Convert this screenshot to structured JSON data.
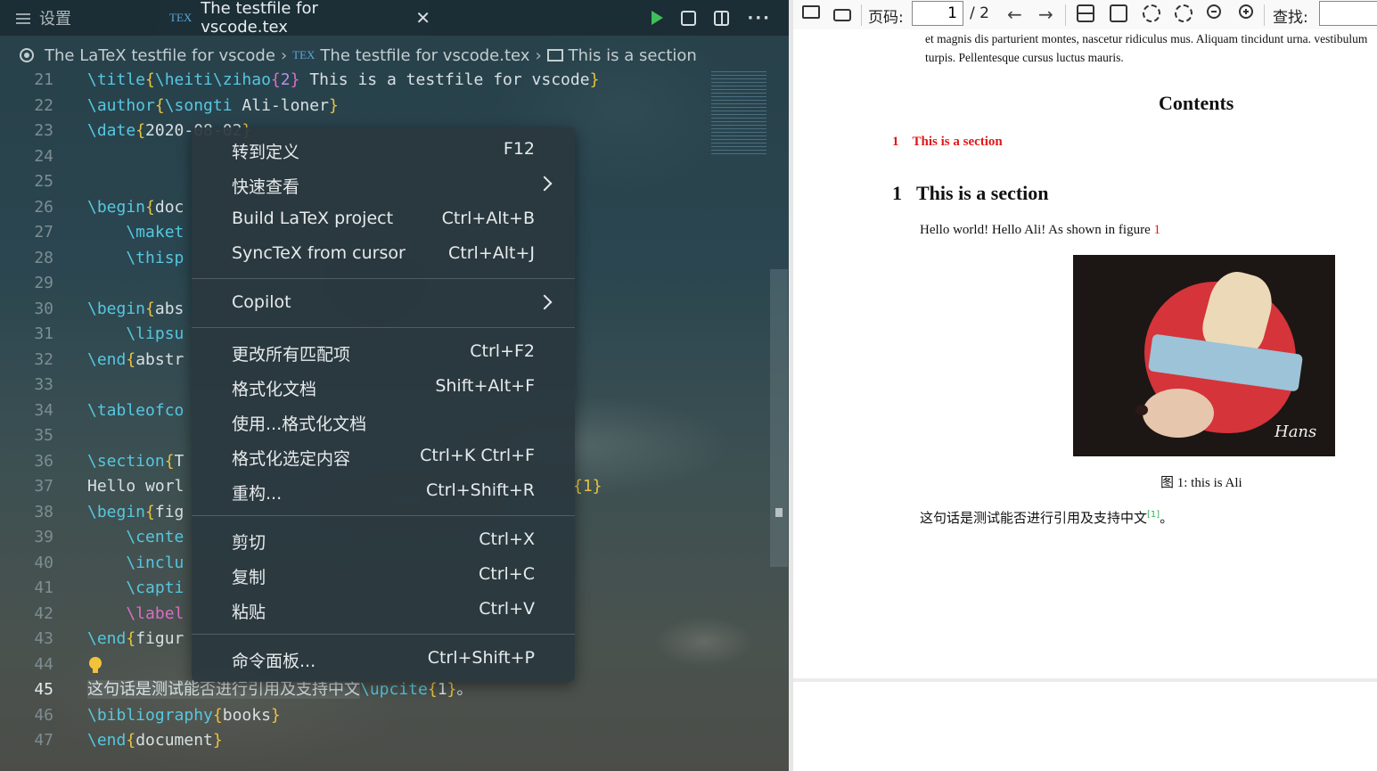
{
  "editor": {
    "tabs": {
      "settings": "设置",
      "active": "The testfile for vscode.tex",
      "tex_icon": "TEX"
    },
    "breadcrumb": {
      "folder": "The LaTeX testfile for vscode",
      "file": "The testfile for vscode.tex",
      "section": "This is a section"
    },
    "lines": [
      {
        "no": "21",
        "text": "\\title{\\heiti\\zihao{2} This is a testfile for vscode}"
      },
      {
        "no": "22",
        "text": "\\author{\\songti Ali-loner}"
      },
      {
        "no": "23",
        "text": "\\date{2020-08-02}"
      },
      {
        "no": "24",
        "text": ""
      },
      {
        "no": "25",
        "text": ""
      },
      {
        "no": "26",
        "text": "\\begin{doc"
      },
      {
        "no": "27",
        "text": "    \\maket"
      },
      {
        "no": "28",
        "text": "    \\thisp"
      },
      {
        "no": "29",
        "text": ""
      },
      {
        "no": "30",
        "text": "\\begin{abs"
      },
      {
        "no": "31",
        "text": "    \\lipsu"
      },
      {
        "no": "32",
        "text": "\\end{abstr"
      },
      {
        "no": "33",
        "text": ""
      },
      {
        "no": "34",
        "text": "\\tableofco"
      },
      {
        "no": "35",
        "text": ""
      },
      {
        "no": "36",
        "text": "\\section{T"
      },
      {
        "no": "37",
        "text": "Hello worl"
      },
      {
        "no": "38",
        "text": "\\begin{fig"
      },
      {
        "no": "39",
        "text": "    \\cente"
      },
      {
        "no": "40",
        "text": "    \\inclu"
      },
      {
        "no": "41",
        "text": "    \\capti"
      },
      {
        "no": "42",
        "text": "    \\label"
      },
      {
        "no": "43",
        "text": "\\end{figur"
      },
      {
        "no": "44",
        "text": ""
      },
      {
        "no": "45",
        "text": "这句话是测试能否进行引用及支持中文\\upcite{1}。"
      },
      {
        "no": "46",
        "text": "\\bibliography{books}"
      },
      {
        "no": "47",
        "text": "\\end{document}"
      }
    ],
    "line37_tail": "{1}",
    "current_line": "45"
  },
  "context_menu": {
    "items": [
      {
        "label": "转到定义",
        "key": "F12"
      },
      {
        "label": "快速查看",
        "key": ""
      },
      {
        "label": "Build LaTeX project",
        "key": "Ctrl+Alt+B"
      },
      {
        "label": "SyncTeX from cursor",
        "key": "Ctrl+Alt+J"
      },
      {
        "label": "Copilot",
        "key": ""
      },
      {
        "label": "更改所有匹配项",
        "key": "Ctrl+F2"
      },
      {
        "label": "格式化文档",
        "key": "Shift+Alt+F"
      },
      {
        "label": "使用...格式化文档",
        "key": ""
      },
      {
        "label": "格式化选定内容",
        "key": "Ctrl+K Ctrl+F"
      },
      {
        "label": "重构...",
        "key": "Ctrl+Shift+R"
      },
      {
        "label": "剪切",
        "key": "Ctrl+X"
      },
      {
        "label": "复制",
        "key": "Ctrl+C"
      },
      {
        "label": "粘贴",
        "key": "Ctrl+V"
      },
      {
        "label": "命令面板...",
        "key": "Ctrl+Shift+P"
      }
    ]
  },
  "pdf": {
    "toolbar": {
      "page_label": "页码:",
      "page_value": "1",
      "page_total": "/ 2",
      "find_label": "查找:"
    },
    "page": {
      "top_text": "et magnis dis parturient montes, nascetur ridiculus mus. Aliquam tincidunt urna. vestibulum turpis. Pellentesque cursus luctus mauris.",
      "contents_title": "Contents",
      "toc_number": "1",
      "toc_title": "This is a section",
      "section_number": "1",
      "section_title": "This is a section",
      "hello_text": "Hello world! Hello Ali! As shown in figure",
      "hello_ref": "1",
      "figure_signature": "Hans",
      "caption": "图 1: this is Ali",
      "cn_text": "这句话是测试能否进行引用及支持中文",
      "cn_cite": "[1]",
      "cn_end": "。"
    }
  }
}
